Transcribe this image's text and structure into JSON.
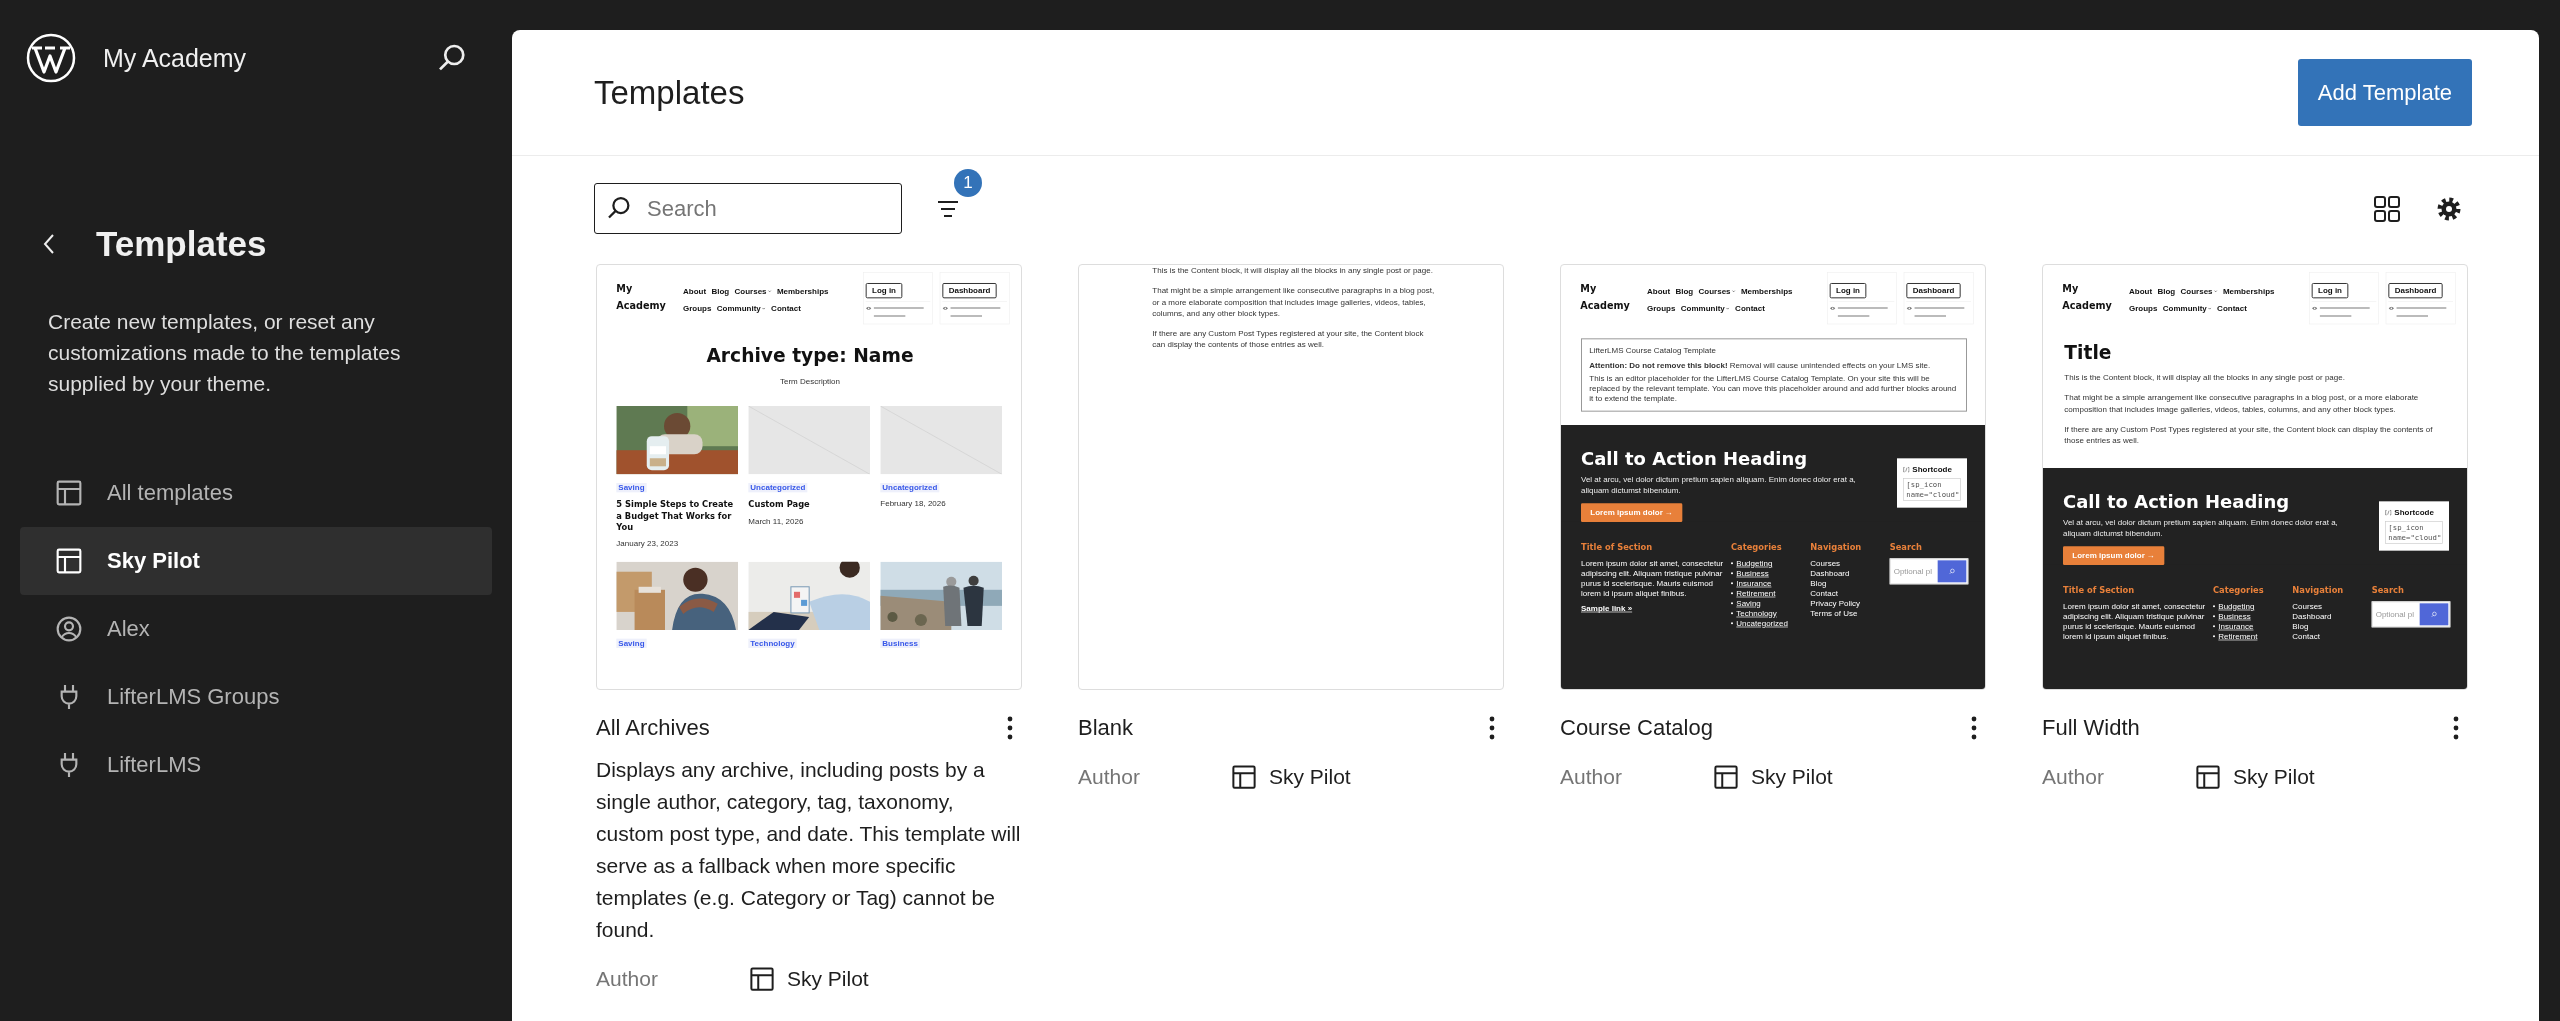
{
  "sidebar": {
    "site_title": "My Academy",
    "title": "Templates",
    "description": "Create new templates, or reset any customizations made to the templates supplied by your theme.",
    "items": [
      {
        "label": "All templates",
        "kind": "layout",
        "selected": false
      },
      {
        "label": "Sky Pilot",
        "kind": "layout",
        "selected": true
      },
      {
        "label": "Alex",
        "kind": "person",
        "selected": false
      },
      {
        "label": "LifterLMS Groups",
        "kind": "plug",
        "selected": false
      },
      {
        "label": "LifterLMS",
        "kind": "plug",
        "selected": false
      }
    ]
  },
  "header": {
    "title": "Templates",
    "add_button": "Add Template"
  },
  "toolbar": {
    "search_placeholder": "Search",
    "filter_count": "1"
  },
  "templates": [
    {
      "name": "All Archives",
      "description": "Displays any archive, including posts by a single author, category, tag, taxonomy, custom post type, and date. This template will serve as a fallback when more specific templates (e.g. Category or Tag) cannot be found.",
      "author_label": "Author",
      "author": "Sky Pilot",
      "preview": [
        {
          "kind": "site_header",
          "site": "My Academy",
          "nav": [
            [
              {
                "label": "About",
                "submenu": false
              },
              {
                "label": "Blog",
                "submenu": false
              },
              {
                "label": "Courses",
                "submenu": true
              },
              {
                "label": "Memberships",
                "submenu": false
              }
            ],
            [
              {
                "label": "Groups",
                "submenu": false
              },
              {
                "label": "Community",
                "submenu": true
              },
              {
                "label": "Contact",
                "submenu": false
              }
            ]
          ],
          "login": "Log in",
          "dashboard": "Dashboard"
        },
        {
          "kind": "archive_title",
          "heading": "Archive type: Name",
          "term": "Term Description"
        },
        {
          "kind": "post_grid",
          "posts": [
            {
              "category": "Saving",
              "title": "5 Simple Steps to Create a Budget That Works for You",
              "date": "January 23, 2023"
            },
            {
              "kind": "placeholder",
              "category": "Uncategorized",
              "title": "Custom Page",
              "date": "March 11, 2026"
            },
            {
              "kind": "placeholder",
              "category": "Uncategorized",
              "date": "February 18, 2026"
            },
            {
              "category": "Saving"
            },
            {
              "category": "Technology"
            },
            {
              "category": "Business"
            }
          ]
        }
      ]
    },
    {
      "name": "Blank",
      "author_label": "Author",
      "author": "Sky Pilot",
      "preview": [
        {
          "kind": "centered_content",
          "paragraphs": [
            "This is the Content block, it will display all the blocks in any single post or page.",
            "That might be a simple arrangement like consecutive paragraphs in a blog post, or a more elaborate composition that includes image galleries, videos, tables, columns, and any other block types.",
            "If there are any Custom Post Types registered at your site, the Content block can display the contents of those entries as well."
          ]
        }
      ]
    },
    {
      "name": "Course Catalog",
      "author_label": "Author",
      "author": "Sky Pilot",
      "preview": [
        {
          "kind": "site_header",
          "site": "My Academy",
          "nav": [
            [
              {
                "label": "About",
                "submenu": false
              },
              {
                "label": "Blog",
                "submenu": false
              },
              {
                "label": "Courses",
                "submenu": true
              },
              {
                "label": "Memberships",
                "submenu": false
              }
            ],
            [
              {
                "label": "Groups",
                "submenu": false
              },
              {
                "label": "Community",
                "submenu": true
              },
              {
                "label": "Contact",
                "submenu": false
              }
            ]
          ],
          "login": "Log in",
          "dashboard": "Dashboard"
        },
        {
          "kind": "lms_placeholder",
          "title": "LifterLMS Course Catalog Template",
          "attention": "**Attention: Do not remove this block!** Removal will cause unintended effects on your LMS site.",
          "note": "This is an editor placeholder for the LifterLMS Course Catalog Template. On your site this will be replaced by the relevant template. You can move this placeholder around and add further blocks around it to extend the template."
        },
        {
          "kind": "cta",
          "heading": "Call to Action Heading",
          "text": "Vel at arcu, vel dolor dictum pretium sapien aliquam. Enim donec dolor erat a, aliquam dictumst bibendum.",
          "button": "Lorem ipsum dolor →",
          "shortcode_label": "Shortcode",
          "shortcode_value": "[sp_icon name=\"cloud\""
        },
        {
          "kind": "footer",
          "columns": [
            {
              "kind": "text",
              "heading": "Title of Section",
              "text": "Lorem ipsum dolor sit amet, consectetur adipiscing elit. Aliquam tristique pulvinar purus id scelerisque. Mauris euismod lorem id ipsum aliquet finibus.",
              "link": "Sample link »"
            },
            {
              "kind": "bullets",
              "heading": "Categories",
              "items": [
                "Budgeting",
                "Business",
                "Insurance",
                "Retirement",
                "Saving",
                "Technology",
                "Uncategorized"
              ]
            },
            {
              "kind": "links",
              "heading": "Navigation",
              "items": [
                "Courses",
                "Dashboard",
                "Blog",
                "Contact",
                "Privacy Policy",
                "Terms of Use"
              ]
            },
            {
              "kind": "search",
              "heading": "Search",
              "placeholder": "Optional pl"
            }
          ]
        }
      ]
    },
    {
      "name": "Full Width",
      "author_label": "Author",
      "author": "Sky Pilot",
      "preview": [
        {
          "kind": "site_header",
          "site": "My Academy",
          "nav": [
            [
              {
                "label": "About",
                "submenu": false
              },
              {
                "label": "Blog",
                "submenu": false
              },
              {
                "label": "Courses",
                "submenu": true
              },
              {
                "label": "Memberships",
                "submenu": false
              }
            ],
            [
              {
                "label": "Groups",
                "submenu": false
              },
              {
                "label": "Community",
                "submenu": true
              },
              {
                "label": "Contact",
                "submenu": false
              }
            ]
          ],
          "login": "Log in",
          "dashboard": "Dashboard"
        },
        {
          "kind": "page_title",
          "heading": "Title"
        },
        {
          "kind": "content",
          "paragraphs": [
            "This is the Content block, it will display all the blocks in any single post or page.",
            "That might be a simple arrangement like consecutive paragraphs in a blog post, or a more elaborate composition that includes image galleries, videos, tables, columns, and any other block types.",
            "If there are any Custom Post Types registered at your site, the Content block can display the contents of those entries as well."
          ]
        },
        {
          "kind": "cta",
          "heading": "Call to Action Heading",
          "text": "Vel at arcu, vel dolor dictum pretium sapien aliquam. Enim donec dolor erat a, aliquam dictumst bibendum.",
          "button": "Lorem ipsum dolor →",
          "shortcode_label": "Shortcode",
          "shortcode_value": "[sp_icon name=\"cloud\""
        },
        {
          "kind": "footer",
          "columns": [
            {
              "kind": "text",
              "heading": "Title of Section",
              "text": "Lorem ipsum dolor sit amet, consectetur adipiscing elit. Aliquam tristique pulvinar purus id scelerisque. Mauris euismod lorem id ipsum aliquet finibus."
            },
            {
              "kind": "bullets",
              "heading": "Categories",
              "items": [
                "Budgeting",
                "Business",
                "Insurance",
                "Retirement"
              ]
            },
            {
              "kind": "links",
              "heading": "Navigation",
              "items": [
                "Courses",
                "Dashboard",
                "Blog",
                "Contact"
              ]
            },
            {
              "kind": "search",
              "heading": "Search",
              "placeholder": "Optional pl"
            }
          ]
        }
      ]
    }
  ]
}
